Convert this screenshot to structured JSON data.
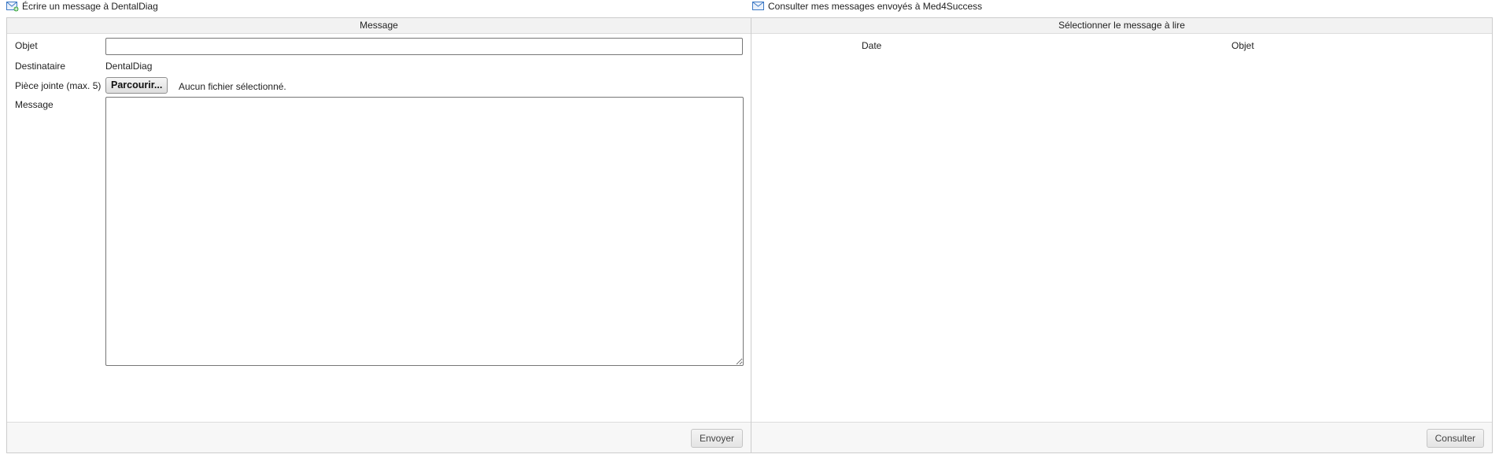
{
  "compose": {
    "header_title": "Écrire un message à DentalDiag",
    "panel_title": "Message",
    "fields": {
      "subject_label": "Objet",
      "subject_value": "",
      "recipient_label": "Destinataire",
      "recipient_value": "DentalDiag",
      "attachment_label": "Pièce jointe (max. 5)",
      "browse_button": "Parcourir...",
      "file_status": "Aucun fichier sélectionné.",
      "message_label": "Message",
      "message_value": ""
    },
    "send_button": "Envoyer"
  },
  "sent": {
    "header_title": "Consulter mes messages envoyés à Med4Success",
    "panel_title": "Sélectionner le message à lire",
    "columns": [
      "Date",
      "Objet"
    ],
    "rows": [],
    "view_button": "Consulter"
  },
  "icons": {
    "compose": "mail-compose-icon",
    "sent": "mail-icon"
  },
  "colors": {
    "panel_header_bg": "#f2f2f2",
    "border": "#cccccc",
    "icon_blue": "#3b78c4",
    "icon_green": "#4caf50"
  }
}
